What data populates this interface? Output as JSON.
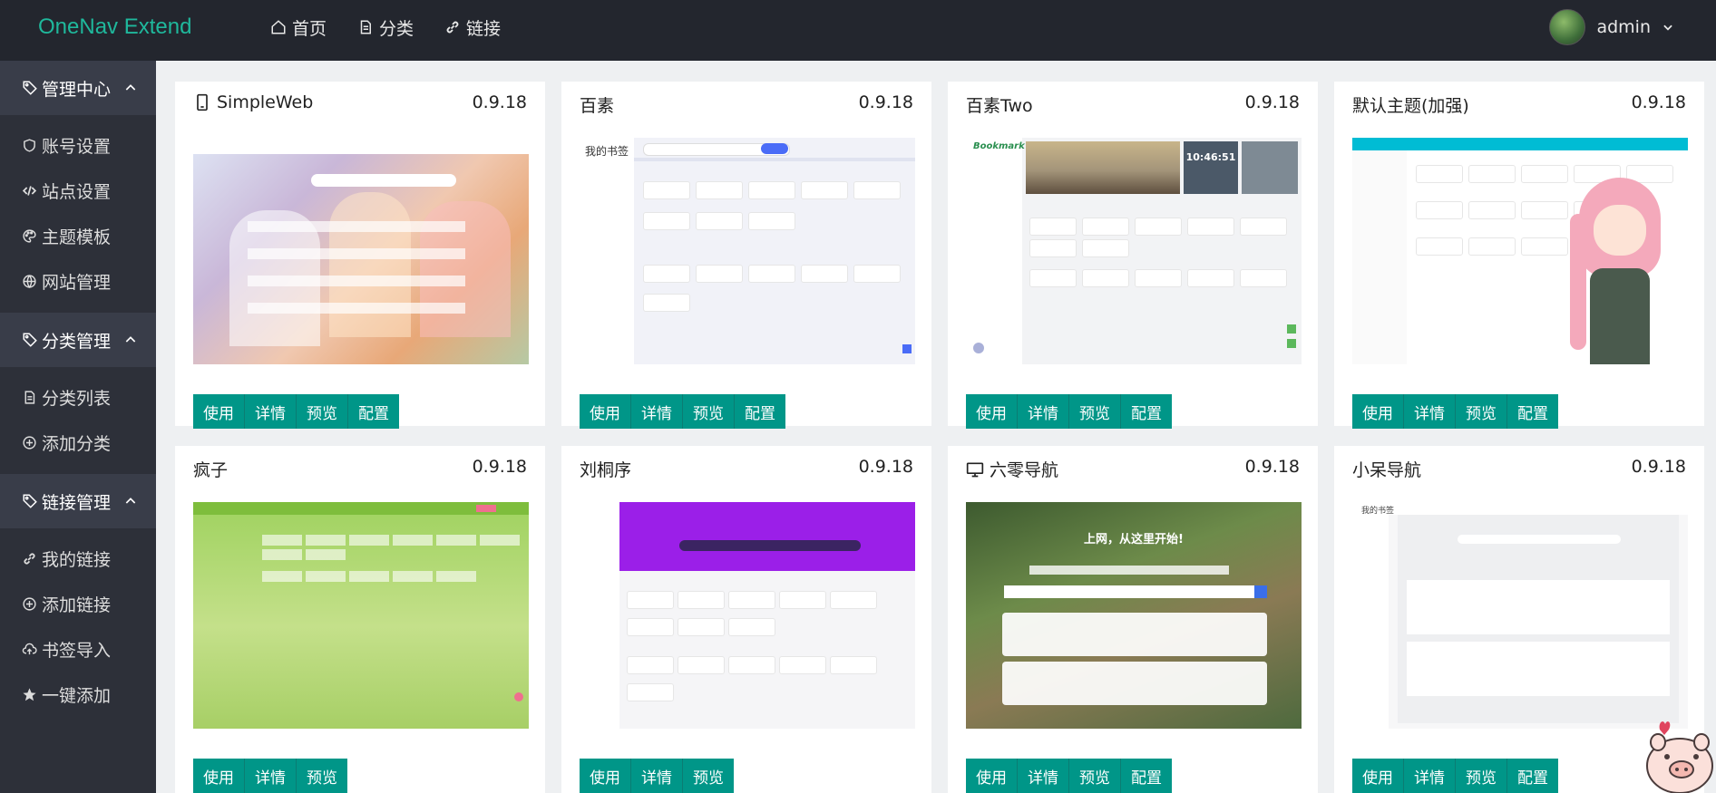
{
  "header": {
    "logo": "OneNav Extend",
    "nav": [
      {
        "label": "首页",
        "icon": "home-icon"
      },
      {
        "label": "分类",
        "icon": "file-icon"
      },
      {
        "label": "链接",
        "icon": "link-icon"
      }
    ],
    "user": {
      "name": "admin"
    }
  },
  "sidebar": {
    "groups": [
      {
        "title": "管理中心",
        "items": [
          "账号设置",
          "站点设置",
          "主题模板",
          "网站管理"
        ]
      },
      {
        "title": "分类管理",
        "items": [
          "分类列表",
          "添加分类"
        ]
      },
      {
        "title": "链接管理",
        "items": [
          "我的链接",
          "添加链接",
          "书签导入",
          "一键添加"
        ]
      }
    ]
  },
  "themes": [
    {
      "name": "SimpleWeb",
      "version": "0.9.18",
      "buttons": [
        "使用",
        "详情",
        "预览",
        "配置"
      ]
    },
    {
      "name": "百素",
      "version": "0.9.18",
      "buttons": [
        "使用",
        "详情",
        "预览",
        "配置"
      ]
    },
    {
      "name": "百素Two",
      "version": "0.9.18",
      "buttons": [
        "使用",
        "详情",
        "预览",
        "配置"
      ]
    },
    {
      "name": "默认主题(加强)",
      "version": "0.9.18",
      "buttons": [
        "使用",
        "详情",
        "预览",
        "配置"
      ]
    },
    {
      "name": "疯子",
      "version": "0.9.18",
      "buttons": [
        "使用",
        "详情",
        "预览"
      ]
    },
    {
      "name": "刘桐序",
      "version": "0.9.18",
      "buttons": [
        "使用",
        "详情",
        "预览"
      ]
    },
    {
      "name": "六零导航",
      "version": "0.9.18",
      "buttons": [
        "使用",
        "详情",
        "预览",
        "配置"
      ]
    },
    {
      "name": "小呆导航",
      "version": "0.9.18",
      "buttons": [
        "使用",
        "详情",
        "预览",
        "配置"
      ]
    }
  ],
  "previews": {
    "baisu_header": "我的书签",
    "baisu_two_clock": "10:46:51",
    "baisu_two_logo": "Bookmark",
    "liuling_hero": "上网，从这里开始!",
    "xiaodai_header": "我的书签"
  },
  "colors": {
    "accent": "#009688",
    "logo": "#1fb89c",
    "header_bg": "#23262e",
    "sidebar_bg": "#2d3039",
    "sidebar_group_bg": "#393d49"
  }
}
